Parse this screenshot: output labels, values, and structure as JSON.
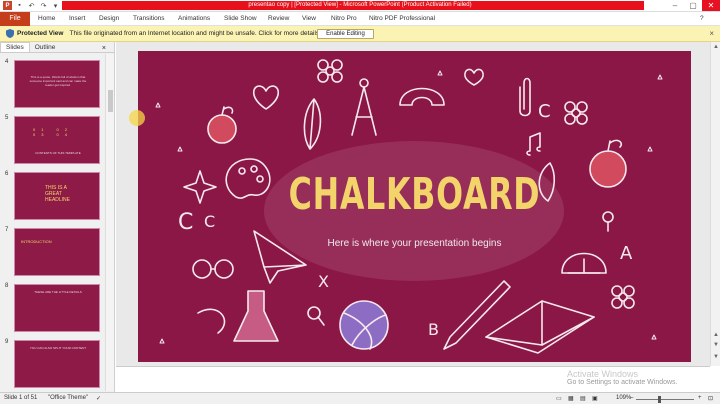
{
  "window": {
    "title": "presentao copy | [Protected View] - Microsoft PowerPoint (Product Activation Failed)",
    "minimize": "–",
    "maximize": "▢",
    "close": "✕"
  },
  "ribbon": {
    "file": "File",
    "tabs": [
      "Home",
      "Insert",
      "Design",
      "Transitions",
      "Animations",
      "Slide Show",
      "Review",
      "View",
      "Nitro Pro",
      "Nitro PDF Professional"
    ]
  },
  "protected_view": {
    "label": "Protected View",
    "message": "This file originated from an Internet location and might be unsafe. Click for more details.",
    "button": "Enable Editing"
  },
  "left_panel": {
    "tabs": [
      "Slides",
      "Outline"
    ],
    "close": "×",
    "thumbnails": [
      {
        "num": "4",
        "title": "",
        "text": "This is a quote. Words full of wisdom that someone important said and can make the reader get inspired."
      },
      {
        "num": "5",
        "title": "01  02  03  04",
        "text": "CONTENTS OF THIS TEMPLATE"
      },
      {
        "num": "6",
        "title": "THIS IS A GREAT HEADLINE",
        "text": ""
      },
      {
        "num": "7",
        "title": "INTRODUCTION",
        "text": ""
      },
      {
        "num": "8",
        "title": "",
        "text": "THESE ARE THE LITTLE DETAILS"
      },
      {
        "num": "9",
        "title": "",
        "text": "YOU CAN ALSO SPLIT YOUR CONTENT"
      }
    ]
  },
  "slide": {
    "title": "CHALKBOARD",
    "subtitle": "Here is where your presentation begins"
  },
  "watermark": {
    "line1": "Activate Windows",
    "line2": "Go to Settings to activate Windows."
  },
  "statusbar": {
    "slide_info": "Slide 1 of 51",
    "theme": "\"Office Theme\"",
    "zoom": "109%"
  },
  "colors": {
    "slide_bg": "#8b1747",
    "title_yellow": "#f2d46a",
    "file_tab": "#c43e1c",
    "protected_bar": "#fbf3b4"
  }
}
